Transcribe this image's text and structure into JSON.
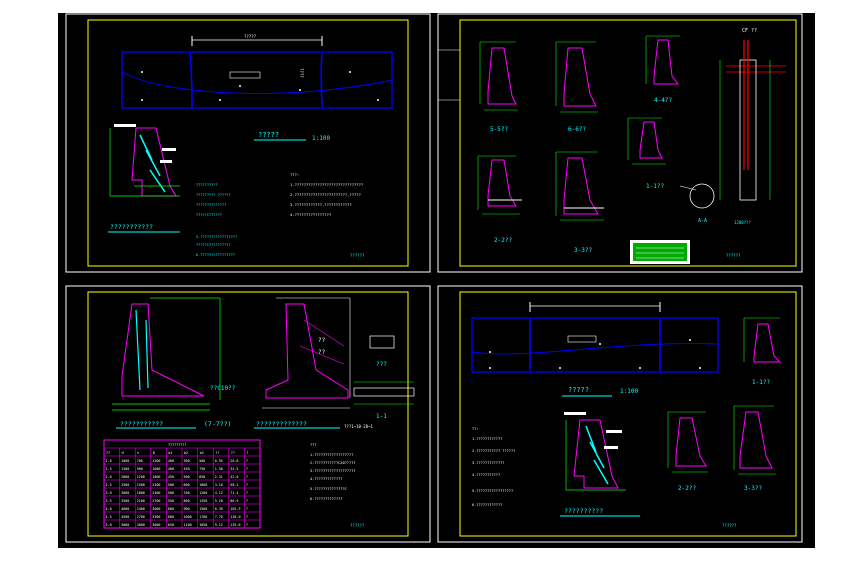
{
  "colors": {
    "background": "#ffffff",
    "cad_space": "#000000",
    "sheet_border": "#ffffff",
    "frame": "#ffff00",
    "wall_section": "#ff00ff",
    "plan_line": "#0000ff",
    "dimension": "#00ff00",
    "label": "#00ffff",
    "hatch": "#ffffff",
    "red_pile": "#ff0000"
  },
  "sheets": {
    "top_left": {
      "plan_title": "?????",
      "plan_scale": "1:100",
      "section_title": "???????????",
      "dim_top": "?????",
      "dim_mid": "????",
      "notes_title": "???:",
      "notes": [
        "1.??????????????????????????????",
        "2.???????????????????????,?????",
        "3.????????????,????????????",
        "4.????????????????"
      ],
      "spec_lines": [
        "??????????",
        "?????????   ??????",
        "??????????????",
        "?????C??????",
        "5.?????????????????",
        "?????C??????????",
        "6.????????????????"
      ],
      "titleblock": "??????"
    },
    "top_right": {
      "sections": [
        "5-5??",
        "6-6??",
        "4-4??",
        "1-1??",
        "2-2??",
        "3-3??"
      ],
      "detail_a": "A-A",
      "top_mark": "CF ??",
      "dim_label": "1200???",
      "titleblock": "??????"
    },
    "bottom_left": {
      "left_title": "???????????",
      "left_subtitle": "(7-7??)",
      "left_dim": "??C10??",
      "mid_title": "?????????????",
      "mid_label_1": "??",
      "mid_label_2": "??",
      "detail_title": "???",
      "detail_title_2": "1-1",
      "detail_note": "???1~10-28~1",
      "table_title": "?????????",
      "table_headers": [
        "??",
        "H",
        "h",
        "B",
        "b1",
        "b2",
        "b3",
        "??",
        "??",
        "?"
      ],
      "table_rows": [
        [
          "1.0",
          "1000",
          "700",
          "1200",
          "400",
          "300",
          "500",
          "0.95",
          "20.8",
          "?"
        ],
        [
          "1.5",
          "1500",
          "900",
          "1600",
          "400",
          "450",
          "750",
          "1.58",
          "34.5",
          "?"
        ],
        [
          "2.0",
          "2000",
          "1200",
          "1800",
          "450",
          "500",
          "850",
          "2.31",
          "42.0",
          "?"
        ],
        [
          "2.5",
          "2500",
          "1500",
          "2100",
          "500",
          "600",
          "1000",
          "3.16",
          "58.2",
          "?"
        ],
        [
          "3.0",
          "3000",
          "1800",
          "2400",
          "500",
          "700",
          "1200",
          "4.12",
          "71.4",
          "?"
        ],
        [
          "3.5",
          "3500",
          "2100",
          "2700",
          "550",
          "800",
          "1350",
          "5.20",
          "86.9",
          "?"
        ],
        [
          "4.0",
          "4000",
          "2400",
          "3000",
          "600",
          "900",
          "1500",
          "6.39",
          "102.5",
          "?"
        ],
        [
          "4.5",
          "4500",
          "2700",
          "3300",
          "600",
          "1000",
          "1700",
          "7.70",
          "118.0",
          "?"
        ],
        [
          "5.0",
          "5000",
          "3000",
          "3600",
          "650",
          "1100",
          "1850",
          "9.12",
          "135.6",
          "?"
        ]
      ],
      "notes": [
        "???",
        "1.??????????????????",
        "2.???????????C20?????",
        "3.???????????????????",
        "4.?????????????",
        "5.??????????????C",
        "6.?????????????"
      ],
      "titleblock": "??????"
    },
    "bottom_right": {
      "plan_title": "?????",
      "plan_scale": "1:100",
      "section_title": "??????????",
      "sections": [
        "1-1??",
        "2-2??",
        "3-3??"
      ],
      "notes_title": "??:",
      "notes": [
        "1.????????????",
        "2.???????????   ??????",
        "3.?????????????",
        "4.???????????",
        "5.?????????????????",
        "6.????????????"
      ],
      "titleblock": "??????"
    }
  }
}
